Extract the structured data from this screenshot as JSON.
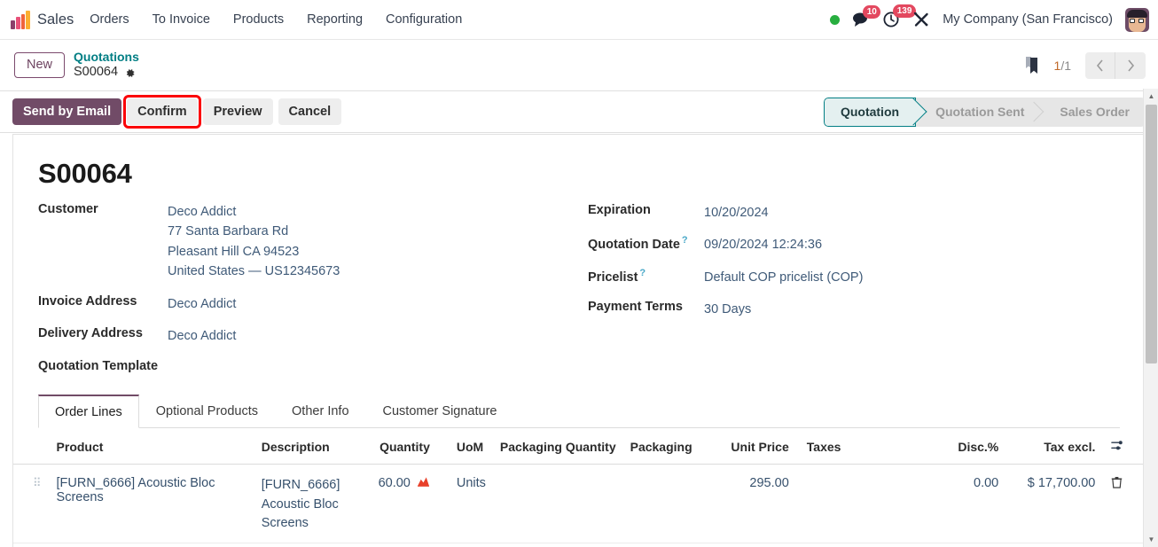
{
  "navbar": {
    "app_name": "Sales",
    "menu": [
      {
        "label": "Orders"
      },
      {
        "label": "To Invoice"
      },
      {
        "label": "Products"
      },
      {
        "label": "Reporting"
      },
      {
        "label": "Configuration"
      }
    ],
    "messages_count": "10",
    "activities_count": "139",
    "company": "My Company (San Francisco)"
  },
  "breadcrumb": {
    "new_label": "New",
    "parent": "Quotations",
    "current": "S00064",
    "pager_current": "1",
    "pager_sep": "/",
    "pager_total": "1"
  },
  "actions": {
    "send_by_email": "Send by Email",
    "confirm": "Confirm",
    "preview": "Preview",
    "cancel": "Cancel",
    "highlight_color": "#fb0007"
  },
  "pipeline": {
    "stages": [
      {
        "label": "Quotation",
        "active": true
      },
      {
        "label": "Quotation Sent",
        "active": false
      },
      {
        "label": "Sales Order",
        "active": false
      }
    ],
    "active_color": "#017e84"
  },
  "form": {
    "title": "S00064",
    "left": [
      {
        "label": "Customer",
        "value": "Deco Addict",
        "extra": [
          "77 Santa Barbara Rd",
          "Pleasant Hill CA 94523",
          "United States — US12345673"
        ]
      },
      {
        "label": "Invoice Address",
        "value": "Deco Addict",
        "extra": []
      },
      {
        "label": "Delivery Address",
        "value": "Deco Addict",
        "extra": []
      },
      {
        "label": "Quotation Template",
        "value": "",
        "extra": []
      }
    ],
    "right": [
      {
        "label": "Expiration",
        "value": "10/20/2024",
        "help": false
      },
      {
        "label": "Quotation Date",
        "value": "09/20/2024 12:24:36",
        "help": true
      },
      {
        "label": "Pricelist",
        "value": "Default COP pricelist (COP)",
        "help": true
      },
      {
        "label": "Payment Terms",
        "value": "30 Days",
        "help": false
      }
    ]
  },
  "tabs": [
    {
      "label": "Order Lines",
      "active": true
    },
    {
      "label": "Optional Products",
      "active": false
    },
    {
      "label": "Other Info",
      "active": false
    },
    {
      "label": "Customer Signature",
      "active": false
    }
  ],
  "order_lines": {
    "columns": [
      "Product",
      "Description",
      "Quantity",
      "UoM",
      "Packaging Quantity",
      "Packaging",
      "Unit Price",
      "Taxes",
      "Disc.%",
      "Tax excl."
    ],
    "rows": [
      {
        "product": "[FURN_6666] Acoustic Bloc Screens",
        "description": "[FURN_6666] Acoustic Bloc Screens",
        "quantity": "60.00",
        "uom": "Units",
        "packaging_quantity": "",
        "packaging": "",
        "unit_price": "295.00",
        "taxes": "",
        "discount": "0.00",
        "tax_excl": "$ 17,700.00"
      }
    ]
  }
}
